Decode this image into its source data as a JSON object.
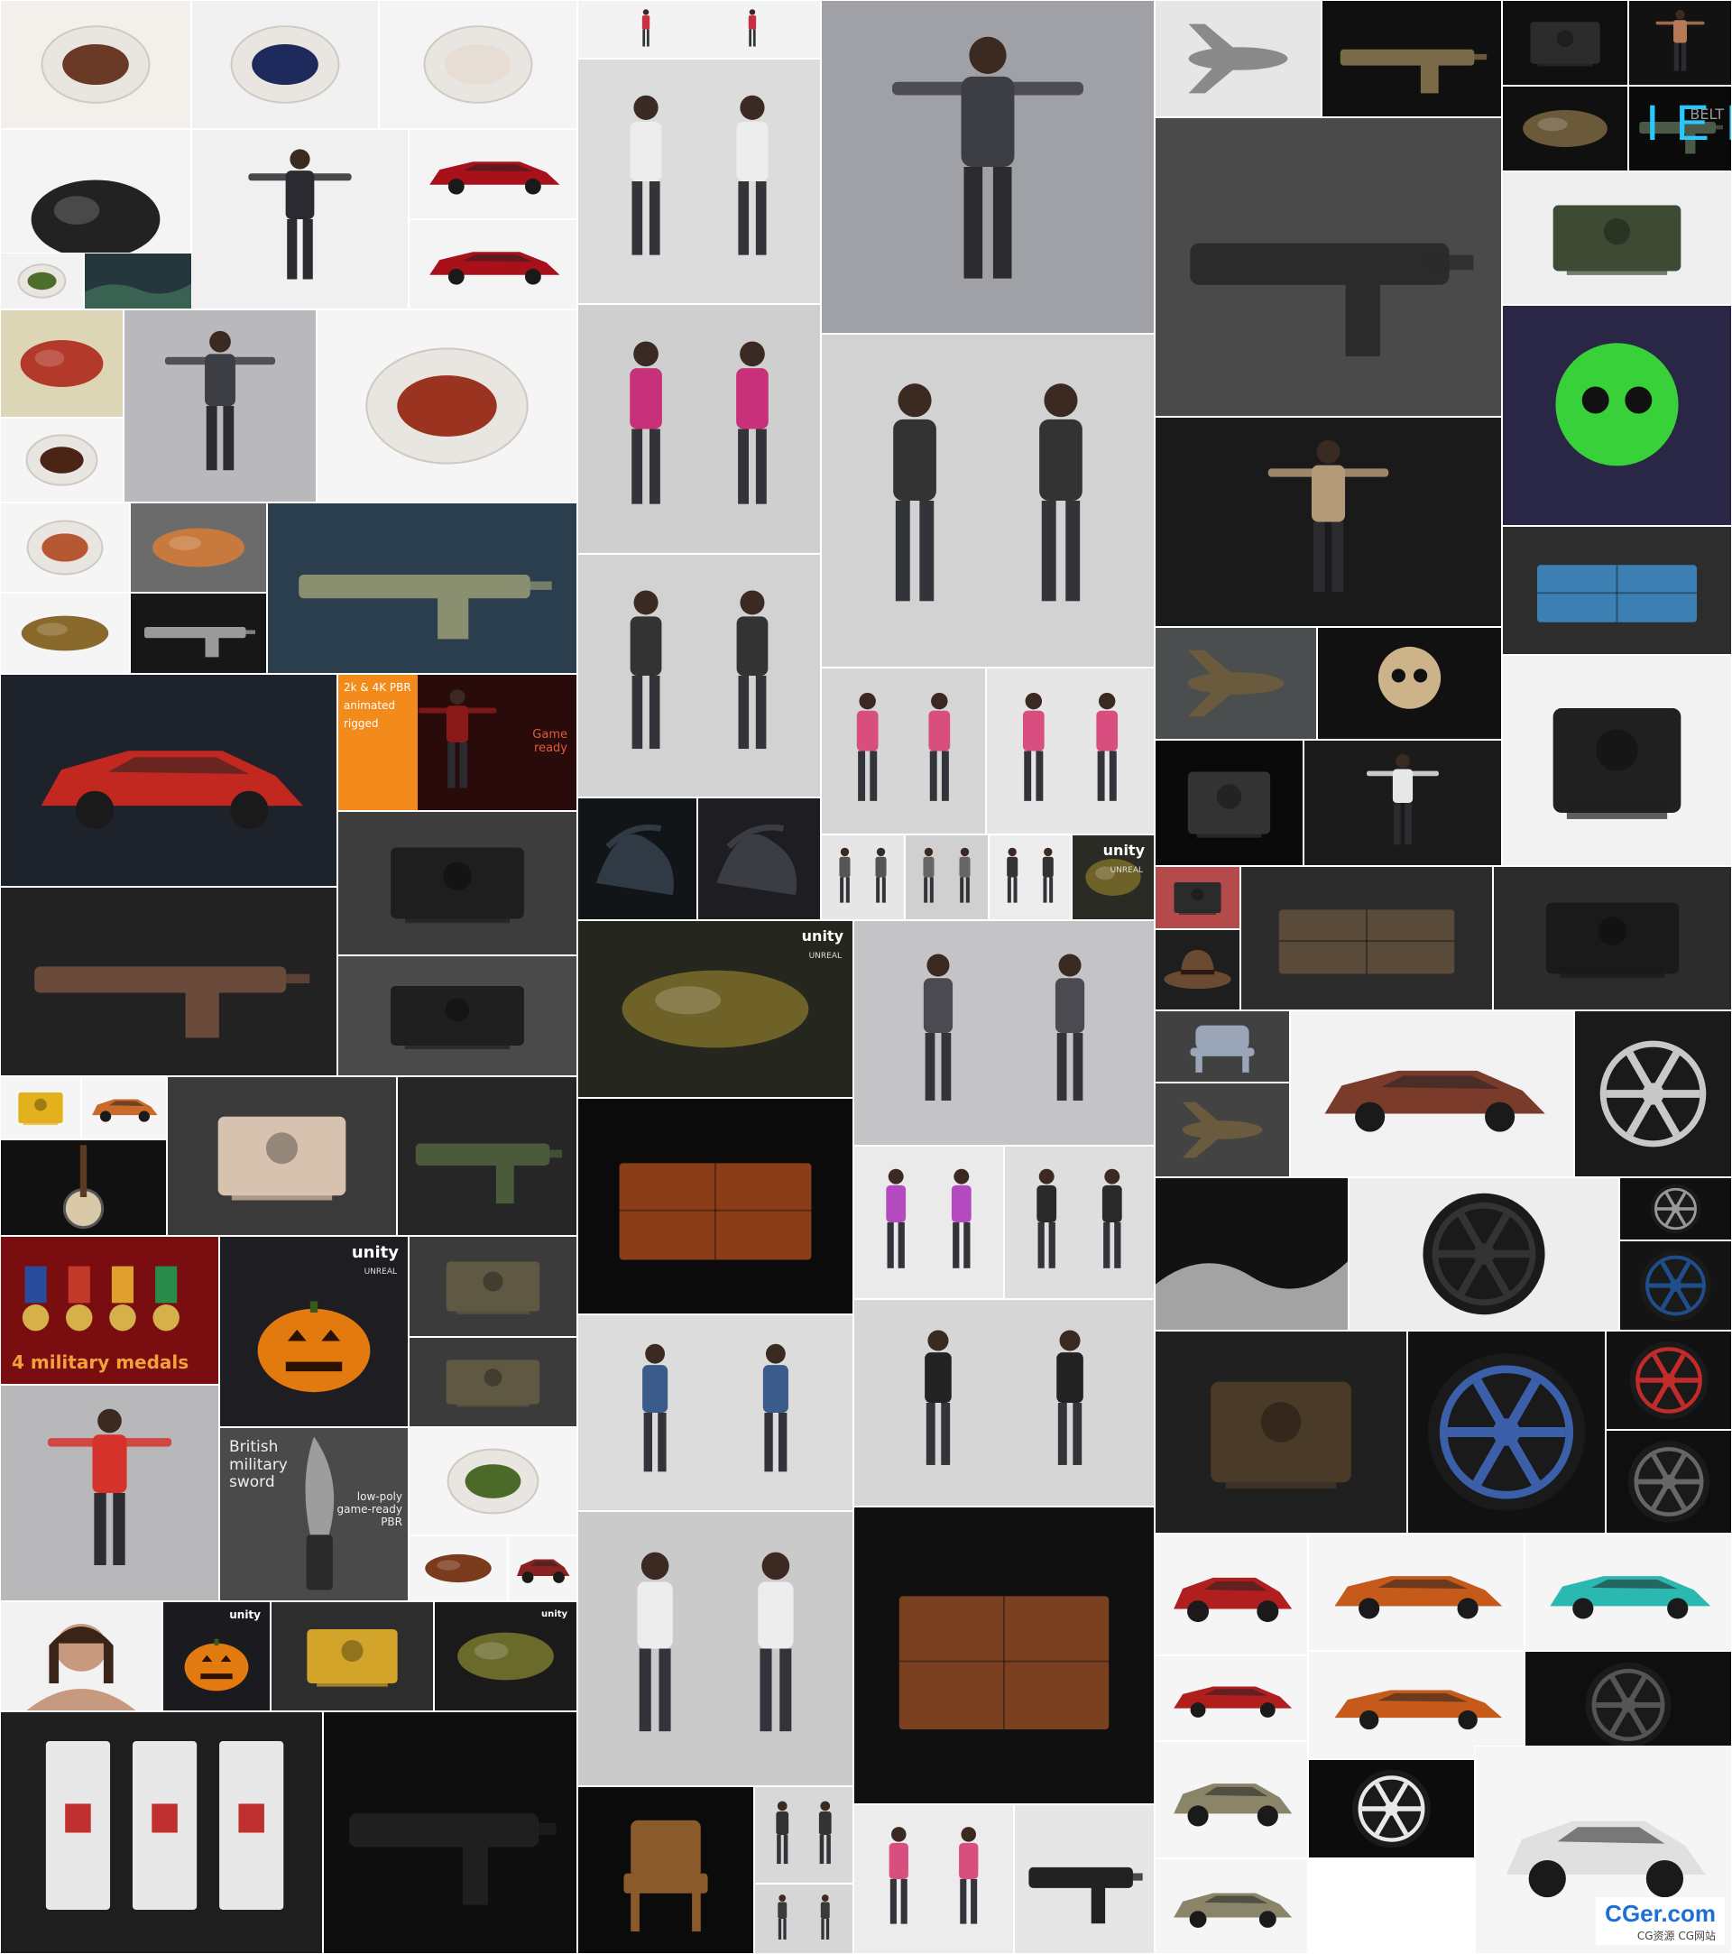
{
  "gallery": {
    "tiles": [
      {
        "name": "grilled-fish-plate",
        "bg": "#f3f0ec",
        "fg": "#6b3a26",
        "shape": "plate"
      },
      {
        "name": "dessert-blue-plate",
        "bg": "#f1f1f1",
        "fg": "#1f2a5c",
        "shape": "plate"
      },
      {
        "name": "dumpling-soup-bowl",
        "bg": "#f4f4f4",
        "fg": "#e6ddd4",
        "shape": "plate"
      },
      {
        "name": "meat-roll-slate",
        "bg": "#f4f4f4",
        "fg": "#222222",
        "shape": "blob"
      },
      {
        "name": "salad-bowl",
        "bg": "#f2f2f2",
        "fg": "#4d6d2a",
        "shape": "plate"
      },
      {
        "name": "landscape-terrain",
        "bg": "#25363d",
        "fg": "#3f6e57",
        "shape": "wave"
      },
      {
        "name": "blue-hair-warrior-girl",
        "bg": "#f0f0f0",
        "fg": "#2a2a30",
        "shape": "figure"
      },
      {
        "name": "red-suv-front",
        "bg": "#f4f4f4",
        "fg": "#a8101a",
        "shape": "car"
      },
      {
        "name": "red-suv-rear",
        "bg": "#f4f4f4",
        "fg": "#a8101a",
        "shape": "car"
      },
      {
        "name": "octopus-tentacle",
        "bg": "#ddd6b6",
        "fg": "#b33a2b",
        "shape": "blob"
      },
      {
        "name": "dessert-plate",
        "bg": "#f5f5f5",
        "fg": "#4a2415",
        "shape": "plate"
      },
      {
        "name": "woman-tpose-grey-shirt",
        "bg": "#b9b9bd",
        "fg": "#3d3d44",
        "shape": "figure"
      },
      {
        "name": "sausage-skewers-plate",
        "bg": "#f5f5f5",
        "fg": "#9a3420",
        "shape": "plate"
      },
      {
        "name": "sliced-sausage-plate",
        "bg": "#f5f5f5",
        "fg": "#b65832",
        "shape": "plate"
      },
      {
        "name": "sushi-board",
        "bg": "#6b6b6b",
        "fg": "#c87a3e",
        "shape": "blob"
      },
      {
        "name": "shark-gun",
        "bg": "#2a3e4e",
        "fg": "#8a8f70",
        "shape": "gun"
      },
      {
        "name": "rice-cake-sticks",
        "bg": "#f5f5f5",
        "fg": "#8a6a2c",
        "shape": "blob"
      },
      {
        "name": "revolver",
        "bg": "#171717",
        "fg": "#9a9a9a",
        "shape": "gun"
      },
      {
        "name": "red-coupe-car",
        "bg": "#1e232b",
        "fg": "#c2281f",
        "shape": "car"
      },
      {
        "name": "guard-character-promo",
        "bg": "#2a0b0b",
        "fg": "#8a1a1a",
        "shape": "figure"
      },
      {
        "name": "machine-engine",
        "bg": "#3d3d3d",
        "fg": "#1e1e1e",
        "shape": "machine"
      },
      {
        "name": "rusty-minigun",
        "bg": "#222222",
        "fg": "#6a4a3a",
        "shape": "gun"
      },
      {
        "name": "engine-variants",
        "bg": "#4a4a4a",
        "fg": "#1f1f1f",
        "shape": "machine"
      },
      {
        "name": "yellow-bulldozer",
        "bg": "#f5f5f5",
        "fg": "#e2b11c",
        "shape": "machine"
      },
      {
        "name": "orange-roadster",
        "bg": "#f5f5f5",
        "fg": "#c96a2a",
        "shape": "car"
      },
      {
        "name": "banjo",
        "bg": "#111111",
        "fg": "#d9c9a8",
        "shape": "banjo"
      },
      {
        "name": "diaphragm-pump",
        "bg": "#3a3a3a",
        "fg": "#d6c2ae",
        "shape": "machine"
      },
      {
        "name": "assault-rifle",
        "bg": "#262626",
        "fg": "#4b5a3a",
        "shape": "gun"
      },
      {
        "name": "military-medals",
        "bg": "#7a0d10",
        "fg": "#d6b04a",
        "shape": "medals"
      },
      {
        "name": "pumpkin-unity",
        "bg": "#1e1e22",
        "fg": "#e37a10",
        "shape": "pumpkin"
      },
      {
        "name": "armored-vehicle-1",
        "bg": "#3b3b3b",
        "fg": "#5f5842",
        "shape": "machine"
      },
      {
        "name": "armored-vehicle-2",
        "bg": "#3b3b3b",
        "fg": "#5f5842",
        "shape": "machine"
      },
      {
        "name": "woman-red-dress",
        "bg": "#b8b8bb",
        "fg": "#d5322b",
        "shape": "figure"
      },
      {
        "name": "british-military-sword",
        "bg": "#4a4a4a",
        "fg": "#9d9d9d",
        "shape": "sword"
      },
      {
        "name": "melon-dessert-bowl",
        "bg": "#f5f5f5",
        "fg": "#4b6a2a",
        "shape": "plate"
      },
      {
        "name": "meat-skewers",
        "bg": "#f5f5f5",
        "fg": "#7a3a1c",
        "shape": "blob"
      },
      {
        "name": "cargo-ship",
        "bg": "#f5f5f5",
        "fg": "#8a2222",
        "shape": "car"
      },
      {
        "name": "woman-bust",
        "bg": "#f2f2f2",
        "fg": "#c79a80",
        "shape": "bust"
      },
      {
        "name": "pumpkin-small",
        "bg": "#1b1b1f",
        "fg": "#e37a10",
        "shape": "pumpkin"
      },
      {
        "name": "road-milling-machine",
        "bg": "#2d2d2d",
        "fg": "#d2a52a",
        "shape": "machine"
      },
      {
        "name": "spiky-larva",
        "bg": "#1a1a1a",
        "fg": "#6a6a2a",
        "shape": "blob"
      },
      {
        "name": "circuit-breakers",
        "bg": "#1e1e1e",
        "fg": "#e8e8e8",
        "shape": "breakers"
      },
      {
        "name": "dark-rifles",
        "bg": "#0e0e0e",
        "fg": "#1f1f1f",
        "shape": "gun"
      },
      {
        "name": "figure-lineup-small",
        "bg": "#f3f3f3",
        "fg": "#c83040",
        "shape": "figures"
      },
      {
        "name": "yoga-pair-seated",
        "bg": "#dcdcdc",
        "fg": "#ededed",
        "shape": "figures"
      },
      {
        "name": "woman-squat-pose",
        "bg": "#9fa1a6",
        "fg": "#3d3d44",
        "shape": "figure"
      },
      {
        "name": "dancers-standing-split",
        "bg": "#cfcfcf",
        "fg": "#c8307a",
        "shape": "figures"
      },
      {
        "name": "kneeling-pair",
        "bg": "#d2d2d2",
        "fg": "#333333",
        "shape": "figures"
      },
      {
        "name": "sitting-pair",
        "bg": "#d2d2d2",
        "fg": "#333333",
        "shape": "figures"
      },
      {
        "name": "alien-queen",
        "bg": "#121518",
        "fg": "#2f3a45",
        "shape": "alien"
      },
      {
        "name": "alien-creature-2",
        "bg": "#1d1d22",
        "fg": "#3a3d44",
        "shape": "alien"
      },
      {
        "name": "bug-larva-unity",
        "bg": "#25261e",
        "fg": "#6e6228",
        "shape": "blob"
      },
      {
        "name": "dresser-cabinet",
        "bg": "#0b0b0b",
        "fg": "#8a3e18",
        "shape": "cabinet"
      },
      {
        "name": "women-in-coats",
        "bg": "#c4c4c6",
        "fg": "#4a4a50",
        "shape": "figures"
      },
      {
        "name": "yoga-bend-pair",
        "bg": "#cdcdcd",
        "fg": "#d84e7e",
        "shape": "figures"
      },
      {
        "name": "men-jackets-pair",
        "bg": "#d6d6d6",
        "fg": "#222222",
        "shape": "figures"
      },
      {
        "name": "women-athletic-pair",
        "bg": "#d6d6d6",
        "fg": "#d84e7e",
        "shape": "figures"
      },
      {
        "name": "small-pair-1",
        "bg": "#e6e6e6",
        "fg": "#d84e7e",
        "shape": "figures"
      },
      {
        "name": "small-pair-2",
        "bg": "#e6e6e6",
        "fg": "#555555",
        "shape": "figures"
      },
      {
        "name": "small-pair-3",
        "bg": "#d0d0d0",
        "fg": "#666666",
        "shape": "figures"
      },
      {
        "name": "small-pair-4",
        "bg": "#ededed",
        "fg": "#333333",
        "shape": "figures"
      },
      {
        "name": "armored-beetle-unity",
        "bg": "#2a2b25",
        "fg": "#6e6228",
        "shape": "blob"
      },
      {
        "name": "women-casual-pair",
        "bg": "#dcdcdc",
        "fg": "#3b5b8a",
        "shape": "figures"
      },
      {
        "name": "yoga-mat-pair",
        "bg": "#eaeaea",
        "fg": "#b44ac0",
        "shape": "figures"
      },
      {
        "name": "yoga-seated-pair-2",
        "bg": "#dedede",
        "fg": "#2a2a2a",
        "shape": "figures"
      },
      {
        "name": "women-tpose-white",
        "bg": "#cacaca",
        "fg": "#ededed",
        "shape": "figures"
      },
      {
        "name": "notice-board",
        "bg": "#101010",
        "fg": "#7a4020",
        "shape": "cabinet"
      },
      {
        "name": "windsor-chair",
        "bg": "#0b0b0b",
        "fg": "#8a5a2a",
        "shape": "chair"
      },
      {
        "name": "sitting-pair-small",
        "bg": "#d8d8d8",
        "fg": "#333333",
        "shape": "figures"
      },
      {
        "name": "women-seated-grey",
        "bg": "#d6d6d6",
        "fg": "#3a3a3a",
        "shape": "figures"
      },
      {
        "name": "women-fitness-group",
        "bg": "#ececec",
        "fg": "#d84e7e",
        "shape": "figures"
      },
      {
        "name": "pistol",
        "bg": "#e6e6e6",
        "fg": "#222222",
        "shape": "gun"
      },
      {
        "name": "starfighter",
        "bg": "#e6e6e6",
        "fg": "#8a8a8a",
        "shape": "jet"
      },
      {
        "name": "shovel-tool",
        "bg": "#101010",
        "fg": "#7a6a48",
        "shape": "gun"
      },
      {
        "name": "dark-machine",
        "bg": "#0f0f0f",
        "fg": "#2c2c2c",
        "shape": "machine"
      },
      {
        "name": "muscular-man",
        "bg": "#121212",
        "fg": "#b87a56",
        "shape": "figure"
      },
      {
        "name": "ornate-relic",
        "bg": "#101010",
        "fg": "#6b5a3a",
        "shape": "blob"
      },
      {
        "name": "iens-belt-device",
        "bg": "#0a0a0a",
        "fg": "#4a5a46",
        "shape": "gun"
      },
      {
        "name": "futuristic-smg",
        "bg": "#4a4a4a",
        "fg": "#2b2b2b",
        "shape": "gun"
      },
      {
        "name": "military-vehicle-pack",
        "bg": "#eeeeee",
        "fg": "#3e4a34",
        "shape": "machine"
      },
      {
        "name": "zombie-pope",
        "bg": "#1a1a1a",
        "fg": "#b59a7a",
        "shape": "figure"
      },
      {
        "name": "green-skulls",
        "bg": "#2a2746",
        "fg": "#39d13a",
        "shape": "skulls"
      },
      {
        "name": "camping-cot",
        "bg": "#2d2d2d",
        "fg": "#3b7fb3",
        "shape": "cabinet"
      },
      {
        "name": "attack-helicopter",
        "bg": "#4a4e4e",
        "fg": "#6a5a3e",
        "shape": "jet"
      },
      {
        "name": "skeleton-skull",
        "bg": "#111111",
        "fg": "#cdb38a",
        "shape": "skulls"
      },
      {
        "name": "robot-vacuum",
        "bg": "#0a0a0a",
        "fg": "#333333",
        "shape": "machine"
      },
      {
        "name": "goddess-statue",
        "bg": "#1b1b1b",
        "fg": "#e7e7e7",
        "shape": "figure"
      },
      {
        "name": "doorbell",
        "bg": "#f2f2f2",
        "fg": "#202020",
        "shape": "machine"
      },
      {
        "name": "camcorder",
        "bg": "#b44a4a",
        "fg": "#2b2b2b",
        "shape": "machine"
      },
      {
        "name": "leather-hat",
        "bg": "#1e1e1e",
        "fg": "#6a4a30",
        "shape": "hat"
      },
      {
        "name": "vcr-player",
        "bg": "#2b2b2b",
        "fg": "#5a4a3a",
        "shape": "cabinet"
      },
      {
        "name": "retro-radio",
        "bg": "#2c2c2c",
        "fg": "#1a1a1a",
        "shape": "machine"
      },
      {
        "name": "armchair",
        "bg": "#414141",
        "fg": "#9aa6b8",
        "shape": "chair"
      },
      {
        "name": "steampunk-airship",
        "bg": "#434343",
        "fg": "#6a5a3e",
        "shape": "jet"
      },
      {
        "name": "hot-rod",
        "bg": "#f2f2f2",
        "fg": "#7a3b2a",
        "shape": "car"
      },
      {
        "name": "silver-wheel",
        "bg": "#1a1a1a",
        "fg": "#c8c8c8",
        "shape": "wheel"
      },
      {
        "name": "stage-hall",
        "bg": "#121212",
        "fg": "#c8c8c8",
        "shape": "wave"
      },
      {
        "name": "wheel-small-1",
        "bg": "#ededed",
        "fg": "#333333",
        "shape": "wheel"
      },
      {
        "name": "wheel-small-2",
        "bg": "#101010",
        "fg": "#999999",
        "shape": "wheel"
      },
      {
        "name": "blue-wheel",
        "bg": "#141414",
        "fg": "#1f4e8a",
        "shape": "wheel"
      },
      {
        "name": "vintage-camera",
        "bg": "#202020",
        "fg": "#4a3a28",
        "shape": "machine"
      },
      {
        "name": "wheel-blue-small",
        "bg": "#111111",
        "fg": "#3b5fa8",
        "shape": "wheel"
      },
      {
        "name": "wheel-red-small",
        "bg": "#111111",
        "fg": "#c22b2b",
        "shape": "wheel"
      },
      {
        "name": "black-wheel",
        "bg": "#0f0f0f",
        "fg": "#666666",
        "shape": "wheel"
      },
      {
        "name": "red-classic-car-1",
        "bg": "#f5f5f5",
        "fg": "#b01e1e",
        "shape": "car"
      },
      {
        "name": "orange-sedan-1",
        "bg": "#f5f5f5",
        "fg": "#c55a1a",
        "shape": "car"
      },
      {
        "name": "teal-beetle",
        "bg": "#f5f5f5",
        "fg": "#2ab8b0",
        "shape": "car"
      },
      {
        "name": "red-classic-car-2",
        "bg": "#f5f5f5",
        "fg": "#b01e1e",
        "shape": "car"
      },
      {
        "name": "orange-sedan-2",
        "bg": "#f5f5f5",
        "fg": "#c55a1a",
        "shape": "car"
      },
      {
        "name": "black-wheel-2",
        "bg": "#0f0f0f",
        "fg": "#555555",
        "shape": "wheel"
      },
      {
        "name": "kubelwagen-1",
        "bg": "#f5f5f5",
        "fg": "#8a8468",
        "shape": "car"
      },
      {
        "name": "white-wheel-large",
        "bg": "#0c0c0c",
        "fg": "#e8e8e8",
        "shape": "wheel"
      },
      {
        "name": "white-van",
        "bg": "#f5f5f5",
        "fg": "#e0e0e0",
        "shape": "car"
      },
      {
        "name": "kubelwagen-2",
        "bg": "#f5f5f5",
        "fg": "#8a8468",
        "shape": "car"
      }
    ]
  },
  "captions": {
    "promo_line1": "2k & 4K PBR",
    "promo_line2": "animated",
    "promo_line3": "rigged",
    "game_ready": "Game\nready",
    "medals": "4 military medals",
    "sword_title": "British\nmilitary\nsword",
    "sword_sub": "low-poly\ngame-ready\nPBR",
    "iens": "IENS",
    "belt": "BELT",
    "unity": "unity",
    "unreal": "UNREAL"
  },
  "watermark": {
    "site": "CGer.com",
    "sub": "CG资源 CG网站"
  },
  "colors": {
    "page_bg": "#ffffff",
    "promo_orange": "#f28a1c",
    "medals_text": "#f2a23a",
    "iens_cyan": "#29c9ff",
    "watermark_blue": "#1d6fd6"
  }
}
